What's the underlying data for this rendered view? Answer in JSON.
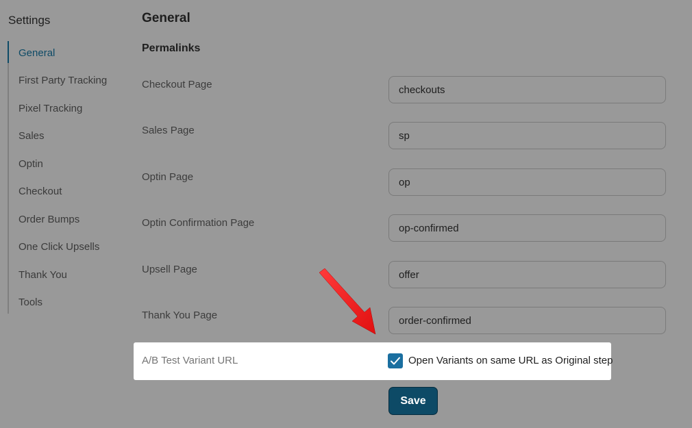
{
  "sidebar": {
    "title": "Settings",
    "items": [
      {
        "label": "General",
        "active": true
      },
      {
        "label": "First Party Tracking",
        "active": false
      },
      {
        "label": "Pixel Tracking",
        "active": false
      },
      {
        "label": "Sales",
        "active": false
      },
      {
        "label": "Optin",
        "active": false
      },
      {
        "label": "Checkout",
        "active": false
      },
      {
        "label": "Order Bumps",
        "active": false
      },
      {
        "label": "One Click Upsells",
        "active": false
      },
      {
        "label": "Thank You",
        "active": false
      },
      {
        "label": "Tools",
        "active": false
      }
    ]
  },
  "main": {
    "title": "General",
    "section_title": "Permalinks",
    "fields": [
      {
        "label": "Checkout Page",
        "value": "checkouts"
      },
      {
        "label": "Sales Page",
        "value": "sp"
      },
      {
        "label": "Optin Page",
        "value": "op"
      },
      {
        "label": "Optin Confirmation Page",
        "value": "op-confirmed"
      },
      {
        "label": "Upsell Page",
        "value": "offer"
      },
      {
        "label": "Thank You Page",
        "value": "order-confirmed"
      }
    ],
    "ab_test": {
      "label": "A/B Test Variant URL",
      "checkbox_label": "Open Variants on same URL as Original step",
      "checked": true
    },
    "save_label": "Save"
  },
  "colors": {
    "accent": "#0d4a66",
    "checkbox": "#1a6fa0",
    "annotation_arrow": "#ff1a1a",
    "overlay_background": "#999999",
    "highlight_background": "#ffffff"
  }
}
